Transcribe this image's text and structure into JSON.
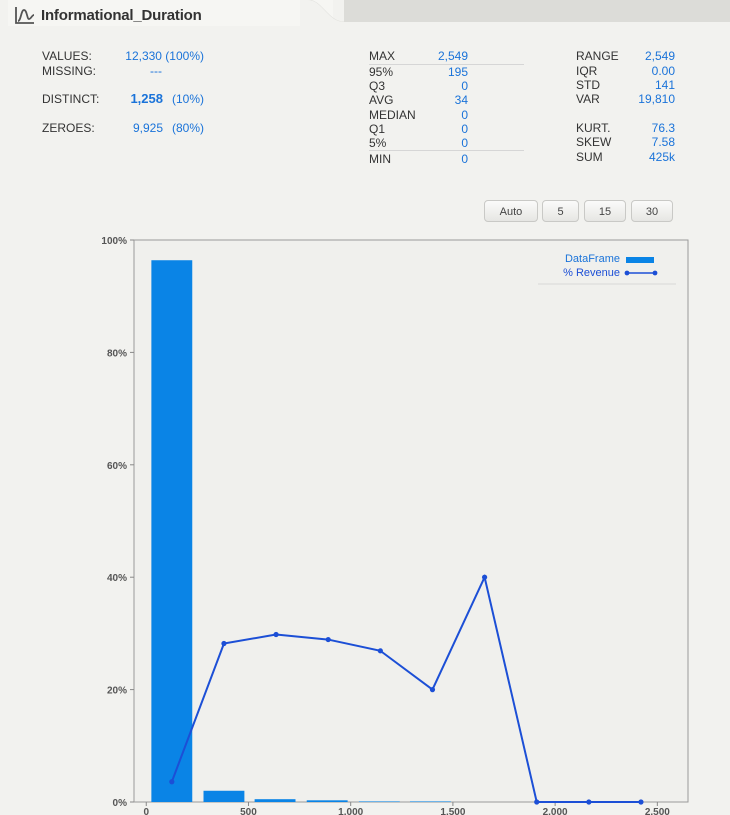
{
  "header": {
    "title": "Informational_Duration",
    "icon": "distribution-icon"
  },
  "stats_left": {
    "values_label": "VALUES:",
    "values_value": "12,330 (100%)",
    "missing_label": "MISSING:",
    "missing_value": "---",
    "distinct_label": "DISTINCT:",
    "distinct_value": "1,258",
    "distinct_pct": "(10%)",
    "zeroes_label": "ZEROES:",
    "zeroes_value": "9,925",
    "zeroes_pct": "(80%)"
  },
  "stats_mid": [
    {
      "label": "MAX",
      "value": "2,549"
    },
    {
      "label": "95%",
      "value": "195"
    },
    {
      "label": "Q3",
      "value": "0"
    },
    {
      "label": "AVG",
      "value": "34"
    },
    {
      "label": "MEDIAN",
      "value": "0"
    },
    {
      "label": "Q1",
      "value": "0"
    },
    {
      "label": "5%",
      "value": "0"
    },
    {
      "label": "MIN",
      "value": "0"
    }
  ],
  "stats_right": [
    {
      "label": "RANGE",
      "value": "2,549"
    },
    {
      "label": "IQR",
      "value": "0.00"
    },
    {
      "label": "STD",
      "value": "141"
    },
    {
      "label": "VAR",
      "value": "19,810"
    },
    {
      "label": "KURT.",
      "value": "76.3"
    },
    {
      "label": "SKEW",
      "value": "7.58"
    },
    {
      "label": "SUM",
      "value": "425k"
    }
  ],
  "bin_buttons": [
    "Auto",
    "5",
    "15",
    "30"
  ],
  "chart_data": {
    "type": "bar",
    "xlim": [
      -60,
      2650
    ],
    "ylim": [
      0,
      100
    ],
    "x_ticks": [
      0,
      500,
      1000,
      1500,
      2000,
      2500
    ],
    "x_tick_labels": [
      "0",
      "500",
      "1,000",
      "1,500",
      "2,000",
      "2,500"
    ],
    "y_ticks": [
      0,
      20,
      40,
      60,
      80,
      100
    ],
    "y_tick_labels": [
      "0%",
      "20%",
      "40%",
      "60%",
      "80%",
      "100%"
    ],
    "bin_width": 200,
    "bins": [
      25,
      280,
      530,
      785,
      1040,
      1290
    ],
    "series": [
      {
        "name": "DataFrame",
        "kind": "bar",
        "color": "#0a84e6",
        "values": [
          96.4,
          2.0,
          0.5,
          0.3,
          0.1,
          0.1
        ]
      },
      {
        "name": "% Revenue",
        "kind": "line",
        "color": "#1c4fd6",
        "x": [
          125,
          380,
          635,
          890,
          1145,
          1400,
          1655,
          1910,
          2165,
          2420
        ],
        "values": [
          3.6,
          28.2,
          29.8,
          28.9,
          26.9,
          20.0,
          40.0,
          0.0,
          0.0,
          0.0
        ]
      }
    ],
    "legend_position": "top-right",
    "grid": false
  }
}
